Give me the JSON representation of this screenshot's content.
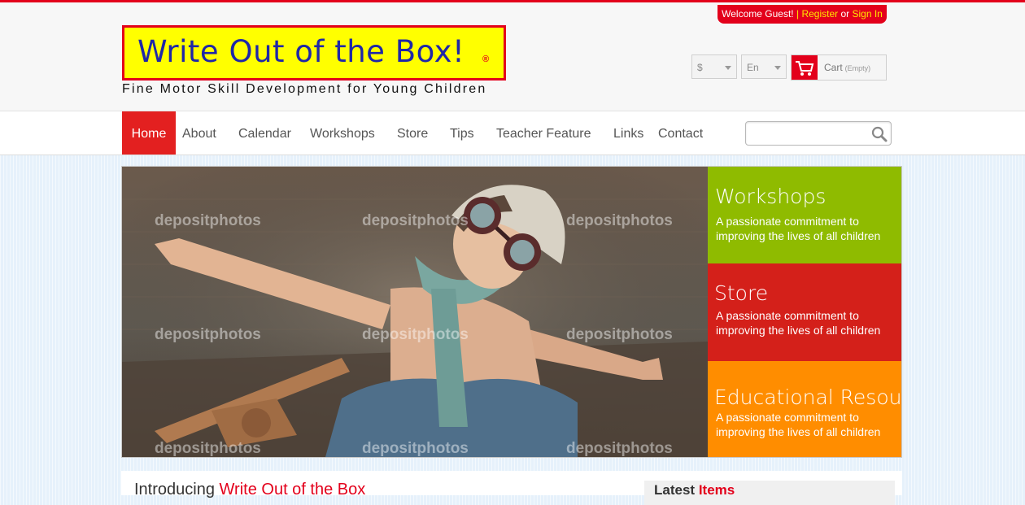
{
  "top_bar": {
    "welcome": "Welcome Guest!",
    "separator": "|",
    "register": "Register",
    "or": "or",
    "sign_in": "Sign In"
  },
  "logo": {
    "text": "Write Out of the Box!",
    "registered": "®",
    "tagline": "Fine Motor Skill Development for Young Children"
  },
  "header_tools": {
    "currency": "$",
    "language": "En",
    "cart_label": "Cart",
    "cart_status": "(Empty)"
  },
  "nav": {
    "items": [
      "Home",
      "About",
      "Calendar",
      "Workshops",
      "Store",
      "Tips",
      "Teacher Feature",
      "Links",
      "Contact"
    ],
    "active": "Home",
    "search_placeholder": ""
  },
  "hero": {
    "watermark": "depositphotos",
    "panels": [
      {
        "title": "Workshops",
        "desc": "A passionate commitment to improving the lives of all children",
        "color": "#8fbb00"
      },
      {
        "title": "Store",
        "desc": "A passionate commitment to improving the lives of all children",
        "color": "#d4201a"
      },
      {
        "title": "Educational Resources",
        "desc": "A passionate commitment to improving the lives of all children",
        "color": "#ff8d00"
      }
    ]
  },
  "content": {
    "intro_prefix": "Introducing",
    "intro_highlight": "Write Out of the Box",
    "latest_prefix": "Latest",
    "latest_highlight": "Items"
  },
  "colors": {
    "brand_red": "#e3001b",
    "logo_yellow": "#ffff00",
    "logo_blue": "#1f27a8"
  }
}
